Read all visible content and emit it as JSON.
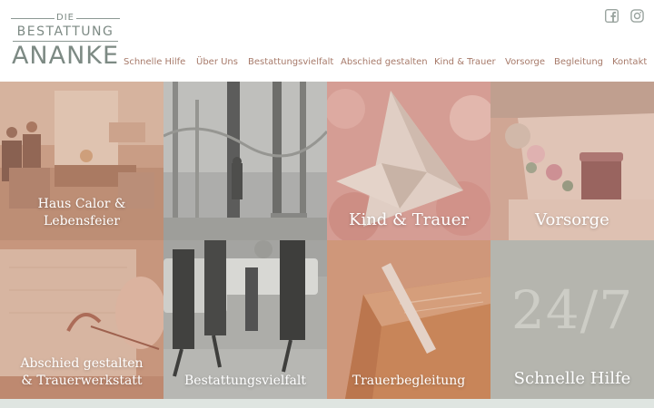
{
  "logo": {
    "die": "DIE",
    "bestattung": "BESTATTUNG",
    "ananke": "ANANKE"
  },
  "social": {
    "facebook_icon": "facebook-icon",
    "instagram_icon": "instagram-icon"
  },
  "nav": {
    "items": [
      {
        "label": "Schnelle Hilfe"
      },
      {
        "label": "Über Uns"
      },
      {
        "label": "Bestattungsvielfalt"
      },
      {
        "label": "Abschied gestalten"
      },
      {
        "label": "Kind & Trauer"
      },
      {
        "label": "Vorsorge"
      },
      {
        "label": "Begleitung"
      },
      {
        "label": "Kontakt"
      }
    ]
  },
  "tiles": [
    {
      "line1": "Haus Calor &",
      "line2": "Lebensfeier"
    },
    {
      "line1": "",
      "line2": ""
    },
    {
      "line1": "Kind & Trauer"
    },
    {
      "line1": "Vorsorge"
    },
    {
      "line1": "Abschied gestalten",
      "line2": "& Trauerwerkstatt"
    },
    {
      "line1": "Bestattungsvielfalt"
    },
    {
      "line1": "Trauerbegleitung"
    },
    {
      "big": "24/7",
      "line1": "Schnelle Hilfe"
    }
  ],
  "colors": {
    "logo": "#7d8a84",
    "nav_text": "#a77a6a",
    "tile_overlay": "#c9977f",
    "tile_247_bg": "#b5b5ae",
    "footer_strip": "#dfe5e1"
  }
}
